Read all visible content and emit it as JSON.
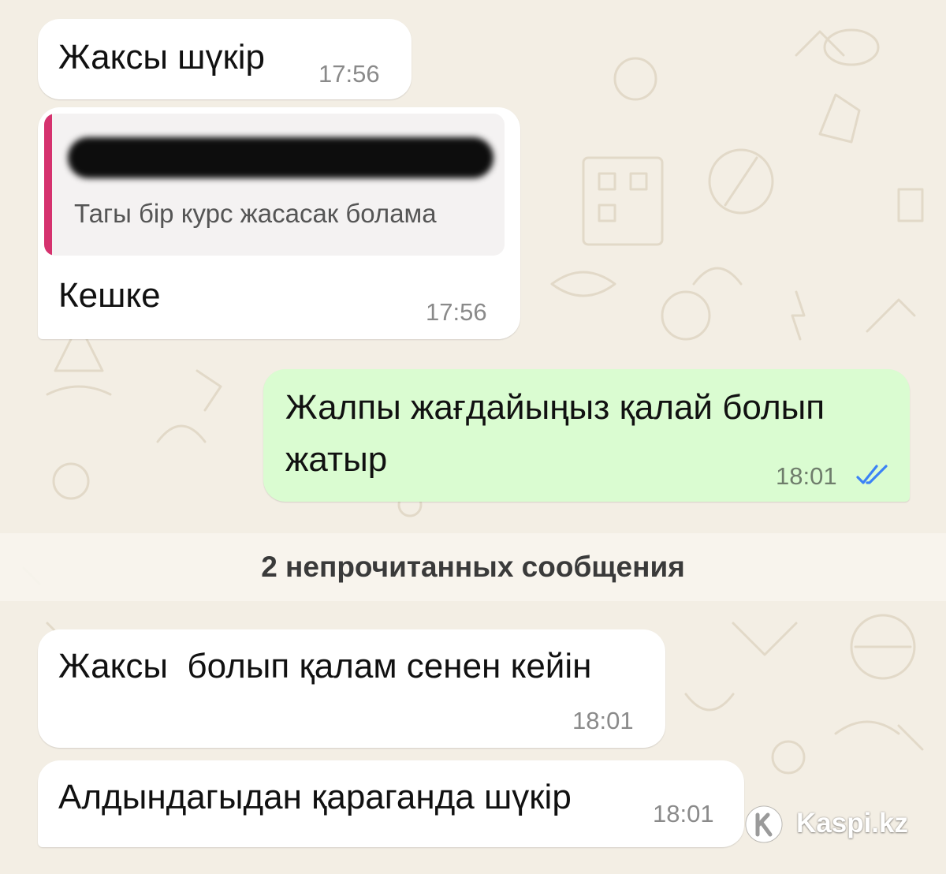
{
  "messages": [
    {
      "direction": "incoming",
      "text": "Жаксы шүкір",
      "time": "17:56"
    },
    {
      "direction": "incoming",
      "reply_to": {
        "sender": "",
        "text": "Тагы бір курс жасасак болама"
      },
      "text": "Кешке",
      "time": "17:56"
    },
    {
      "direction": "outgoing",
      "text_lines": [
        "Жалпы жағдайыңыз қалай болып",
        "жатыр"
      ],
      "time": "18:01",
      "status": "read",
      "status_icon": "double-check-icon",
      "status_color": "#3b82f6"
    },
    {
      "direction": "incoming",
      "text": "Жаксы  болып қалам сенен кейін",
      "time": "18:01"
    },
    {
      "direction": "incoming",
      "text": "Алдындагыдан қараганда шүкір",
      "time": "18:01"
    }
  ],
  "unread_separator": {
    "label": "2 непрочитанных сообщения"
  },
  "watermark": {
    "text": "Kaspi.kz",
    "icon": "kaspi-logo-icon"
  },
  "colors": {
    "background": "#f3eee4",
    "incoming_bubble": "#ffffff",
    "outgoing_bubble": "#dafcd1",
    "reply_bar": "#d5326e",
    "read_ticks": "#3b82f6"
  }
}
